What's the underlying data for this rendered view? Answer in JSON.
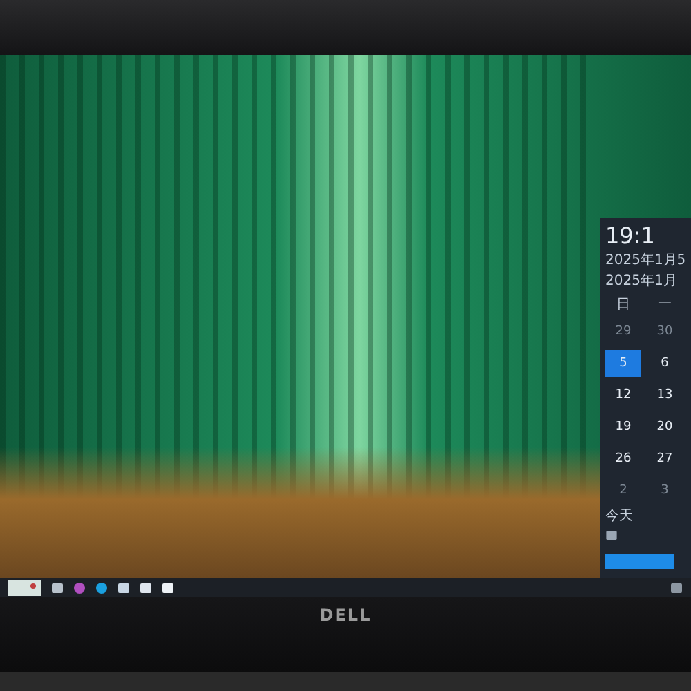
{
  "calendar_flyout": {
    "time": "19:1",
    "date": "2025年1月5",
    "month_title": "2025年1月",
    "weekdays": [
      "日",
      "一"
    ],
    "days": [
      {
        "label": "29",
        "selected": false,
        "dim": true
      },
      {
        "label": "30",
        "selected": false,
        "dim": true
      },
      {
        "label": "5",
        "selected": true,
        "dim": false
      },
      {
        "label": "6",
        "selected": false,
        "dim": false
      },
      {
        "label": "12",
        "selected": false,
        "dim": false
      },
      {
        "label": "13",
        "selected": false,
        "dim": false
      },
      {
        "label": "19",
        "selected": false,
        "dim": false
      },
      {
        "label": "20",
        "selected": false,
        "dim": false
      },
      {
        "label": "26",
        "selected": false,
        "dim": false
      },
      {
        "label": "27",
        "selected": false,
        "dim": false
      },
      {
        "label": "2",
        "selected": false,
        "dim": true
      },
      {
        "label": "3",
        "selected": false,
        "dim": true
      }
    ],
    "today_label": "今天"
  },
  "monitor": {
    "brand": "DELL"
  }
}
